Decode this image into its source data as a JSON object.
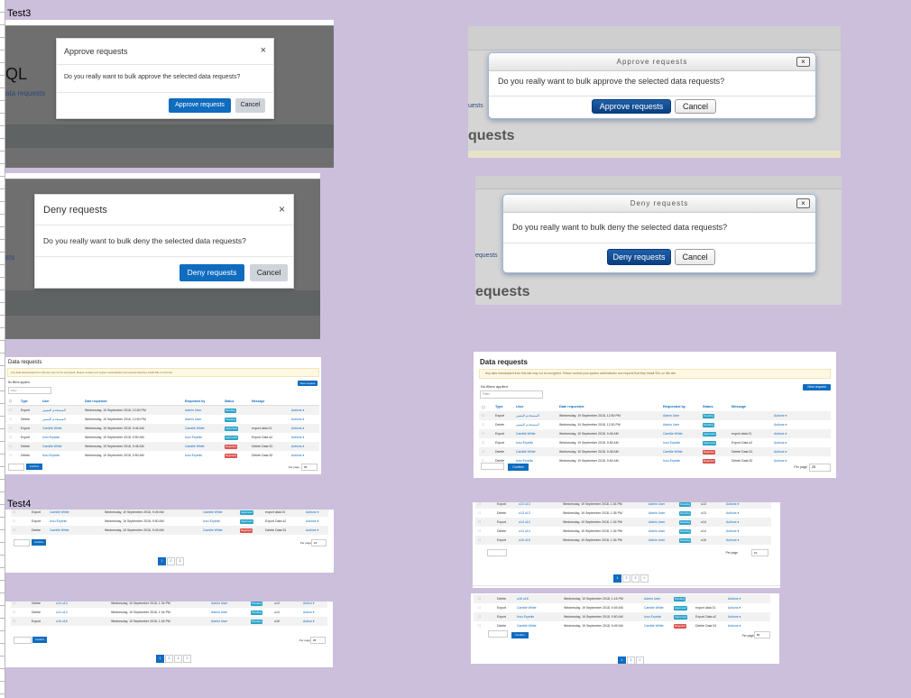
{
  "sheet_labels": {
    "test3": "Test3",
    "test4": "Test4"
  },
  "approve_modal": {
    "title": "Approve requests",
    "body": "Do you really want to bulk approve the selected data requests?",
    "confirm": "Approve requests",
    "cancel": "Cancel"
  },
  "deny_modal": {
    "title": "Deny requests",
    "body": "Do you really want to bulk deny the selected data requests?",
    "confirm": "Deny requests",
    "cancel": "Cancel"
  },
  "bg_fragments": {
    "ql": "QL",
    "data_requests_link": "ata requests",
    "sts": "sts",
    "quests_link": "uests",
    "quests_heading": "quests",
    "equests_link": "equests",
    "equests_heading": "equests"
  },
  "close_glyph": "×",
  "data_requests": {
    "title": "Data requests",
    "warning": "Any data downloaded from this site may not be encrypted. Please contact your system administrator and request that they install SSL on this site.",
    "new_request": "New request",
    "filters": "No filters applied",
    "filter_placeholder": "Filter",
    "columns": [
      "Type",
      "User",
      "Date requested",
      "Requested by",
      "Status",
      "Message"
    ],
    "rows": [
      {
        "type": "Export",
        "user": "المستخدم المتميز",
        "date": "Wednesday, 19 September 2018, 12:50 PM",
        "by": "Admin User",
        "status": "Pending",
        "status_class": "b-pending",
        "message": "",
        "actions": "Actions ▾"
      },
      {
        "type": "Delete",
        "user": "المستخدم المتميز",
        "date": "Wednesday, 19 September 2018, 12:50 PM",
        "by": "Admin User",
        "status": "Pending",
        "status_class": "b-pending",
        "message": "",
        "actions": "Actions ▾"
      },
      {
        "type": "Export",
        "user": "Camille White",
        "date": "Wednesday, 19 September 2018, 9:46 AM",
        "by": "Camille White",
        "status": "Approved",
        "status_class": "b-approved",
        "message": "export data 01",
        "actions": "Actions ▾"
      },
      {
        "type": "Export",
        "user": "Izou Eryshin",
        "date": "Wednesday, 19 September 2018, 9:50 AM",
        "by": "Izou Eryshin",
        "status": "Approved",
        "status_class": "b-approved",
        "message": "Export Data s2",
        "actions": "Actions ▾"
      },
      {
        "type": "Delete",
        "user": "Camille White",
        "date": "Wednesday, 19 September 2018, 9:48 AM",
        "by": "Camille White",
        "status": "Rejected",
        "status_class": "b-rejected",
        "message": "Delete Data 51",
        "actions": "Actions ▾"
      },
      {
        "type": "Delete",
        "user": "Izou Eryshin",
        "date": "Wednesday, 19 September 2018, 9:50 AM",
        "by": "Izou Eryshin",
        "status": "Rejected",
        "status_class": "b-rejected",
        "message": "Delete Data 52",
        "actions": "Actions ▾"
      }
    ],
    "confirm": "Confirm",
    "per_page": "Per page",
    "per_page_value": "25"
  },
  "test4_left_top": {
    "rows": [
      {
        "type": "Export",
        "user": "Camille White",
        "date": "Wednesday, 19 September 2018, 9:49 AM",
        "by": "Camille White",
        "status": "Approved",
        "status_class": "b-approved",
        "message": "export data 01",
        "actions": "Actions ▾"
      },
      {
        "type": "Export",
        "user": "Izou Eryshin",
        "date": "Wednesday, 19 September 2018, 9:50 AM",
        "by": "Izou Eryshin",
        "status": "Approved",
        "status_class": "b-approved",
        "message": "Export Data s2",
        "actions": "Actions ▾"
      },
      {
        "type": "Delete",
        "user": "Camille White",
        "date": "Wednesday, 19 September 2018, 9:49 AM",
        "by": "Camille White",
        "status": "Rejected",
        "status_class": "b-rejected",
        "message": "Delete Data 51",
        "actions": "Actions ▾"
      }
    ],
    "pages": [
      "1",
      "2",
      "3"
    ],
    "per_page_value": "10"
  },
  "test4_left_bottom": {
    "rows": [
      {
        "type": "Delete",
        "user": "u14 u14",
        "date": "Wednesday, 19 September 2018, 1:34 PM",
        "by": "Admin User",
        "status": "Pending",
        "status_class": "b-pending",
        "message": "u14",
        "actions": "Action ▾"
      },
      {
        "type": "Delete",
        "user": "u14 u14",
        "date": "Wednesday, 19 September 2018, 1:34 PM",
        "by": "Admin User",
        "status": "Pending",
        "status_class": "b-pending",
        "message": "u14",
        "actions": "Action ▾"
      },
      {
        "type": "Export",
        "user": "u16 u16",
        "date": "Wednesday, 19 September 2018, 1:34 PM",
        "by": "Admin User",
        "status": "Pending",
        "status_class": "b-pending",
        "message": "u16",
        "actions": "Action ▾"
      }
    ],
    "pages": [
      "1",
      "2",
      "3",
      "»"
    ],
    "per_page_value": "25"
  },
  "test4_right_top": {
    "rows": [
      {
        "type": "Export",
        "user": "u13 u13",
        "date": "Wednesday, 19 September 2018, 1:34 PM",
        "by": "Admin User",
        "status": "Pending",
        "status_class": "b-pending",
        "message": "u13",
        "actions": "Actions ▾"
      },
      {
        "type": "Delete",
        "user": "u13 u13",
        "date": "Wednesday, 19 September 2018, 1:35 PM",
        "by": "Admin User",
        "status": "Pending",
        "status_class": "b-pending",
        "message": "u13",
        "actions": "Actions ▾"
      },
      {
        "type": "Export",
        "user": "u14 u14",
        "date": "Wednesday, 19 September 2018, 1:34 PM",
        "by": "Admin User",
        "status": "Pending",
        "status_class": "b-pending",
        "message": "u14",
        "actions": "Actions ▾"
      },
      {
        "type": "Delete",
        "user": "u14 u14",
        "date": "Wednesday, 19 September 2018, 1:34 PM",
        "by": "Admin User",
        "status": "Pending",
        "status_class": "b-pending",
        "message": "u14",
        "actions": "Actions ▾"
      },
      {
        "type": "Export",
        "user": "u16 u16",
        "date": "Wednesday, 19 September 2018, 1:34 PM",
        "by": "Admin User",
        "status": "Pending",
        "status_class": "b-pending",
        "message": "u16",
        "actions": "Actions ▾"
      }
    ],
    "pages": [
      "1",
      "2",
      "3",
      "»"
    ],
    "per_page_value": "10"
  },
  "test4_right_bottom": {
    "rows": [
      {
        "type": "Delete",
        "user": "u16 u16",
        "date": "Wednesday, 19 September 2018, 1:16 PM",
        "by": "Admin User",
        "status": "Pending",
        "status_class": "b-pending",
        "message": "",
        "actions": "Actions ▾"
      },
      {
        "type": "Export",
        "user": "Camille White",
        "date": "Wednesday, 19 September 2018, 9:49 AM",
        "by": "Camille White",
        "status": "Approved",
        "status_class": "b-approved",
        "message": "export data 01",
        "actions": "Actions ▾"
      },
      {
        "type": "Export",
        "user": "Izou Eryshin",
        "date": "Wednesday, 19 September 2018, 9:50 AM",
        "by": "Izou Eryshin",
        "status": "Approved",
        "status_class": "b-approved",
        "message": "Export Data s2",
        "actions": "Actions ▾"
      },
      {
        "type": "Delete",
        "user": "Camille White",
        "date": "Wednesday, 19 September 2018, 9:49 AM",
        "by": "Camille White",
        "status": "Rejected",
        "status_class": "b-rejected",
        "message": "Delete Data 51",
        "actions": "Actions ▾"
      }
    ],
    "pages": [
      "1",
      "2",
      "»"
    ],
    "per_page_value": "50"
  }
}
